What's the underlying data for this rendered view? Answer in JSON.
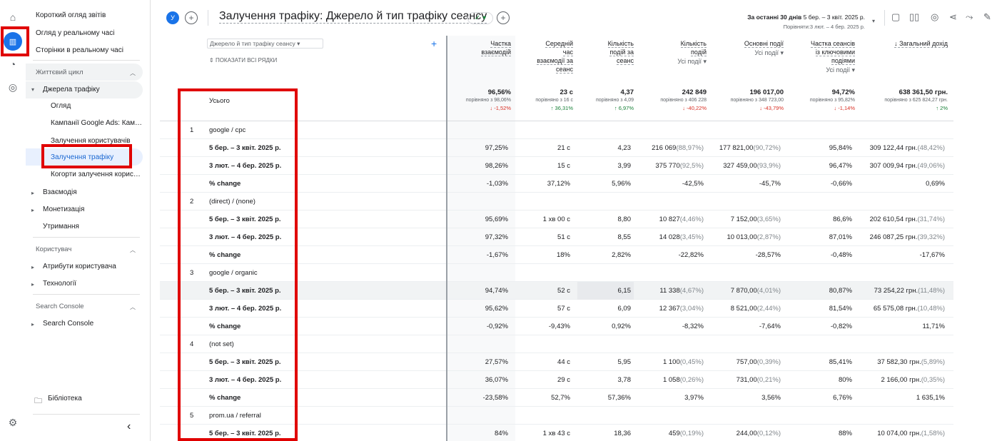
{
  "nav": {
    "items": [
      "Короткий огляд звітів",
      "Огляд у реальному часі",
      "Сторінки в реальному часі"
    ],
    "lifecycle": "Життєвий цикл",
    "traffic": "Джерела трафіку",
    "traffic_items": [
      "Огляд",
      "Кампанії Google Ads: Кам…",
      "Залучення користувачів",
      "Залучення трафіку",
      "Когорти залучення корис…"
    ],
    "engagement": "Взаємодія",
    "monetization": "Монетизація",
    "retention": "Утримання",
    "user": "Користувач",
    "user_attr": "Атрибути користувача",
    "tech": "Технології",
    "sc_hdr": "Search Console",
    "sc": "Search Console",
    "library": "Бібліотека",
    "collapse": "‹"
  },
  "header": {
    "avatar": "У",
    "title": "Залучення трафіку: Джерело й тип трафіку сеансу",
    "date_label": "За останні 30 днів",
    "date_range": "5 бер. – 3 квіт. 2025 р.",
    "compare": "Порівняти:3 лют. – 4 бер. 2025 р."
  },
  "table": {
    "dim_picker": "Джерело й тип трафіку сеансу",
    "show_all": "ПОКАЗАТИ ВСІ РЯДКИ",
    "total_label": "Усього",
    "columns": [
      {
        "l": [
          "Частка",
          "взаємодій"
        ],
        "sub": ""
      },
      {
        "l": [
          "Середній",
          "час",
          "взаємодії за",
          "сеанс"
        ],
        "sub": ""
      },
      {
        "l": [
          "Кількість",
          "подій за",
          "сеанс"
        ],
        "sub": ""
      },
      {
        "l": [
          "Кількість",
          "подій"
        ],
        "sub": "Усі події"
      },
      {
        "l": [
          "Основні події"
        ],
        "sub": "Усі події"
      },
      {
        "l": [
          "Частка сеансів",
          "із ключовими",
          "подіями"
        ],
        "sub": "Усі події"
      },
      {
        "l": [
          "↓ Загальний дохід"
        ],
        "sub": ""
      }
    ],
    "totals": [
      {
        "v": "96,56%",
        "c": "порівняно з 98,06%",
        "d": "↓ -1,52%",
        "neg": true
      },
      {
        "v": "23 с",
        "c": "порівняно з 16 с",
        "d": "↑ 36,31%",
        "neg": false
      },
      {
        "v": "4,37",
        "c": "порівняно з 4,09",
        "d": "↑ 6,97%",
        "neg": false
      },
      {
        "v": "242 849",
        "c": "порівняно з 406 228",
        "d": "↓ -40,22%",
        "neg": true
      },
      {
        "v": "196 017,00",
        "c": "порівняно з 348 723,00",
        "d": "↓ -43,79%",
        "neg": true
      },
      {
        "v": "94,72%",
        "c": "порівняно з 95,82%",
        "d": "↓ -1,14%",
        "neg": true
      },
      {
        "v": "638 361,50 грн.",
        "c": "порівняно з 625 824,27 грн.",
        "d": "↑ 2%",
        "neg": false
      }
    ],
    "rows": [
      {
        "type": "group",
        "idx": "1",
        "label": "google / cpc"
      },
      {
        "type": "data",
        "label": "5 бер. – 3 квіт. 2025 р.",
        "cells": [
          "97,25%",
          "21 с",
          "4,23",
          "216 069|(88,97%)",
          "177 821,00|(90,72%)",
          "95,84%",
          "309 122,44 грн.|(48,42%)"
        ]
      },
      {
        "type": "data",
        "label": "3 лют. – 4 бер. 2025 р.",
        "cells": [
          "98,26%",
          "15 с",
          "3,99",
          "375 770|(92,5%)",
          "327 459,00|(93,9%)",
          "96,47%",
          "307 009,94 грн.|(49,06%)"
        ]
      },
      {
        "type": "data",
        "label": "% change",
        "cells": [
          "-1,03%",
          "37,12%",
          "5,96%",
          "-42,5%",
          "-45,7%",
          "-0,66%",
          "0,69%"
        ]
      },
      {
        "type": "group",
        "idx": "2",
        "label": "(direct) / (none)"
      },
      {
        "type": "data",
        "label": "5 бер. – 3 квіт. 2025 р.",
        "cells": [
          "95,69%",
          "1 хв 00 с",
          "8,80",
          "10 827|(4,46%)",
          "7 152,00|(3,65%)",
          "86,6%",
          "202 610,54 грн.|(31,74%)"
        ]
      },
      {
        "type": "data",
        "label": "3 лют. – 4 бер. 2025 р.",
        "cells": [
          "97,32%",
          "51 с",
          "8,55",
          "14 028|(3,45%)",
          "10 013,00|(2,87%)",
          "87,01%",
          "246 087,25 грн.|(39,32%)"
        ]
      },
      {
        "type": "data",
        "label": "% change",
        "cells": [
          "-1,67%",
          "18%",
          "2,82%",
          "-22,82%",
          "-28,57%",
          "-0,48%",
          "-17,67%"
        ]
      },
      {
        "type": "group",
        "idx": "3",
        "label": "google / organic"
      },
      {
        "type": "data",
        "shade": true,
        "label": "5 бер. – 3 квіт. 2025 р.",
        "cells": [
          "94,74%",
          "52 с",
          "6,15",
          "11 338|(4,67%)",
          "7 870,00|(4,01%)",
          "80,87%",
          "73 254,22 грн.|(11,48%)"
        ]
      },
      {
        "type": "data",
        "label": "3 лют. – 4 бер. 2025 р.",
        "cells": [
          "95,62%",
          "57 с",
          "6,09",
          "12 367|(3,04%)",
          "8 521,00|(2,44%)",
          "81,54%",
          "65 575,08 грн.|(10,48%)"
        ]
      },
      {
        "type": "data",
        "label": "% change",
        "cells": [
          "-0,92%",
          "-9,43%",
          "0,92%",
          "-8,32%",
          "-7,64%",
          "-0,82%",
          "11,71%"
        ]
      },
      {
        "type": "group",
        "idx": "4",
        "label": "(not set)"
      },
      {
        "type": "data",
        "label": "5 бер. – 3 квіт. 2025 р.",
        "cells": [
          "27,57%",
          "44 с",
          "5,95",
          "1 100|(0,45%)",
          "757,00|(0,39%)",
          "85,41%",
          "37 582,30 грн.|(5,89%)"
        ]
      },
      {
        "type": "data",
        "label": "3 лют. – 4 бер. 2025 р.",
        "cells": [
          "36,07%",
          "29 с",
          "3,78",
          "1 058|(0,26%)",
          "731,00|(0,21%)",
          "80%",
          "2 166,00 грн.|(0,35%)"
        ]
      },
      {
        "type": "data",
        "label": "% change",
        "cells": [
          "-23,58%",
          "52,7%",
          "57,36%",
          "3,97%",
          "3,56%",
          "6,76%",
          "1 635,1%"
        ]
      },
      {
        "type": "group",
        "idx": "5",
        "label": "prom.ua / referral"
      },
      {
        "type": "data",
        "label": "5 бер. – 3 квіт. 2025 р.",
        "cells": [
          "84%",
          "1 хв 43 с",
          "18,36",
          "459|(0,19%)",
          "244,00|(0,12%)",
          "88%",
          "10 074,00 грн.|(1,58%)"
        ]
      }
    ]
  }
}
